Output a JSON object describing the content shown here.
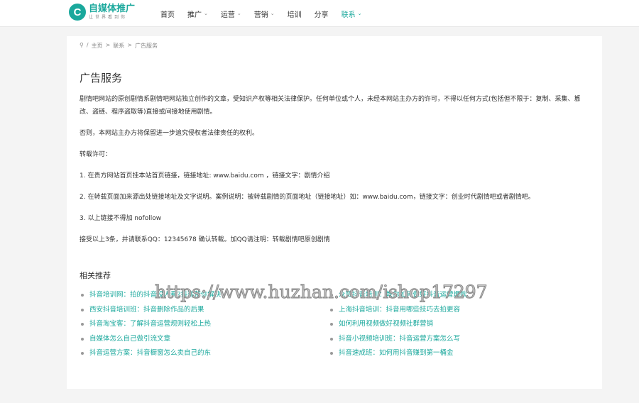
{
  "logo": {
    "mark": "C",
    "title": "自媒体推广",
    "subtitle": "让世界看到你"
  },
  "nav": [
    {
      "label": "首页",
      "dropdown": false
    },
    {
      "label": "推广",
      "dropdown": true
    },
    {
      "label": "运营",
      "dropdown": true
    },
    {
      "label": "营销",
      "dropdown": true
    },
    {
      "label": "培训",
      "dropdown": false
    },
    {
      "label": "分享",
      "dropdown": false
    },
    {
      "label": "联系",
      "dropdown": true,
      "active": true
    }
  ],
  "breadcrumb": {
    "sep": "/",
    "home": "主页",
    "arrow1": ">",
    "section": "联系",
    "arrow2": ">",
    "current": "广告服务"
  },
  "page_title": "广告服务",
  "paragraphs": [
    "剧情吧网站的原创剧情系剧情吧网站独立创作的文章，受知识产权等相关法律保护。任何单位或个人，未经本网站主办方的许可，不得以任何方式(包括但不限于：复制、采集、篡改、盗链、程序盗取等)直接或间接地使用剧情。",
    "否则，本网站主办方将保留进一步追究侵权者法律责任的权利。",
    "转载许可：",
    "1. 在贵方网站首页挂本站首页链接，链接地址: www.baidu.com ，链接文字：剧情介绍",
    "2. 在转载页面加来源出处链接地址及文字说明。案例说明：被转载剧情的页面地址（链接地址）如：www.baidu.com，链接文字：创业时代剧情吧或者剧情吧。",
    "3. 以上链接不得加 nofollow",
    "接受以上3条，并请联系QQ：12345678 确认转载。加QQ请注明：转载剧情吧原创剧情"
  ],
  "related": {
    "title": "相关推荐",
    "items": [
      "抖音培训网：拍的抖音没人看?抖客帮你解决",
      "众赞抖音培训：教你如何做好抖音运营爆款",
      "西安抖音培训班：抖音删除作品的后果",
      "上海抖音培训：抖音用哪些技巧去拍更容",
      "抖音淘宝客：了解抖音运营规则轻松上热",
      "如何利用视频做好视频社群营销",
      "自媒体怎么自己做引流文章",
      "抖音小视频培训班：抖音运营方案怎么写",
      "抖音运营方案：抖音橱窗怎么卖自己的东",
      "抖音速成班：如何用抖音赚到第一桶金"
    ]
  },
  "watermark": "https://www.huzhan.com/ishop17297",
  "colors": {
    "accent": "#1aa89c"
  }
}
